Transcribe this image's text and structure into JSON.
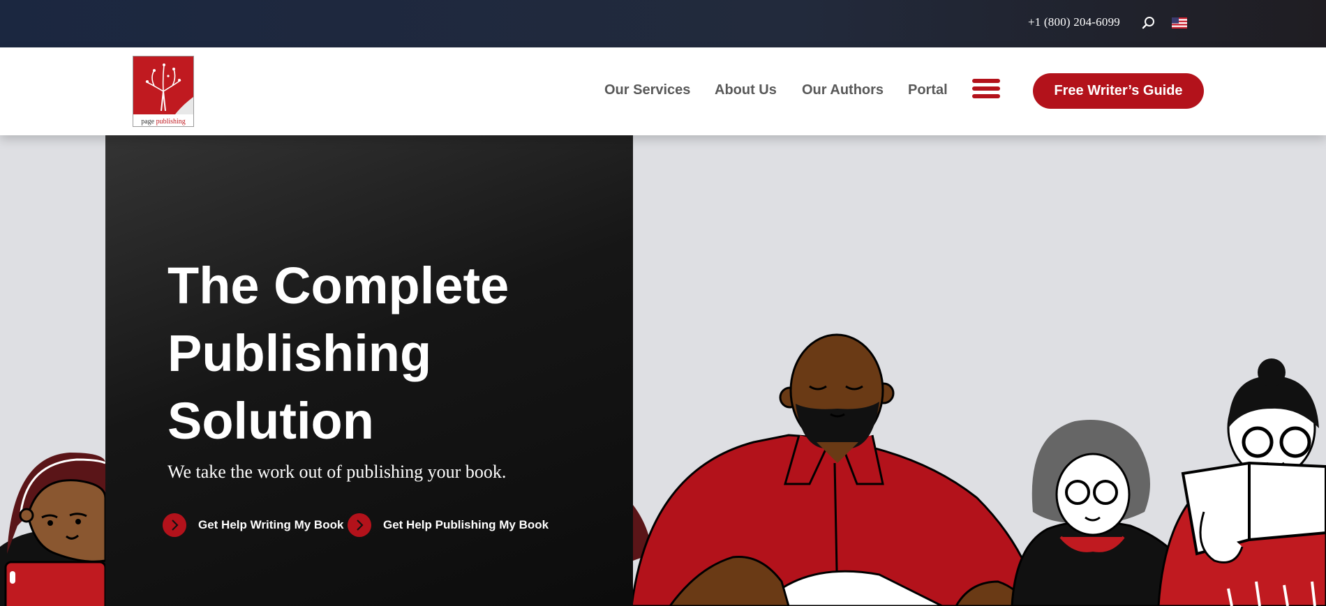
{
  "topbar": {
    "phone": "+1 (800) 204-6099",
    "search_icon": "search-icon",
    "flag_icon": "us-flag-icon"
  },
  "logo": {
    "word_prefix": "page ",
    "word_suffix": "publishing"
  },
  "nav": {
    "items": [
      {
        "label": "Our Services"
      },
      {
        "label": "About Us"
      },
      {
        "label": "Our Authors"
      },
      {
        "label": "Portal"
      }
    ],
    "menu_icon": "hamburger-menu-icon"
  },
  "cta": {
    "label": "Free Writer’s Guide"
  },
  "hero": {
    "title_lines": [
      "The Complete",
      "Publishing",
      "Solution"
    ],
    "tagline": "We take the work out of publishing your book.",
    "links": [
      {
        "label": "Get Help Writing My Book"
      },
      {
        "label": "Get Help Publishing My Book"
      }
    ]
  },
  "colors": {
    "brand_red": "#b3121b",
    "topbar_navy": "#1b2740",
    "panel_black": "#161616"
  }
}
